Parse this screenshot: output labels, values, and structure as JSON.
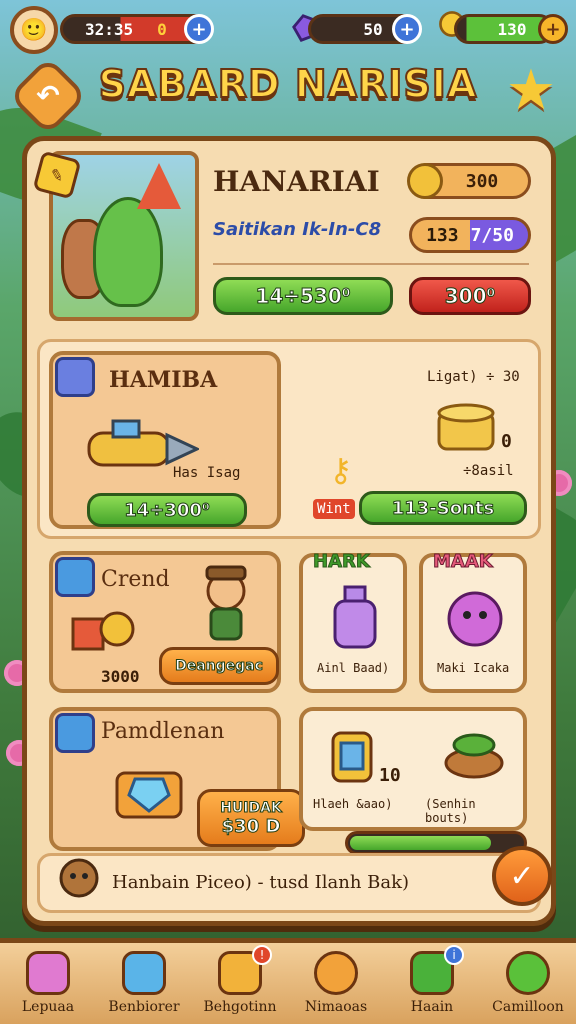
{
  "topbar": {
    "energy_value": "32:35",
    "energy_count": "0",
    "gems_value": "50",
    "coins_value": "130"
  },
  "header": {
    "title": "SABARD NARISIA"
  },
  "hero": {
    "name": "HANARIAI",
    "subtitle": "Saitikan Ik-In-C8",
    "coin_amount": "300",
    "progress_left": "133",
    "progress_right": "7/50",
    "green_button": "14÷530⁰",
    "red_button": "300⁰"
  },
  "section1": {
    "left_title": "HAMIBA",
    "left_caption": "Has Isag",
    "left_button": "14÷300⁰",
    "right_top_text": "Ligat) ÷ 30",
    "right_counter": "0",
    "right_mid_text": "÷8asil",
    "right_tag": "Wint",
    "right_button": "113-Sonts"
  },
  "section2": {
    "card1_title": "Crend",
    "card1_count": "3000",
    "card1_button": "Deangegac",
    "card2_title": "HARK",
    "card2_caption": "Ainl Baad)",
    "card3_title": "MAAK",
    "card3_caption": "Maki Icaka"
  },
  "section3": {
    "card1_title": "Pamdlenan",
    "card1_button_top": "HUIDAK",
    "card1_button_bottom": "$30 D",
    "card2_count": "10",
    "card2_caption_left": "Hlaeh &aao)",
    "card2_caption_right": "(Senhin bouts)"
  },
  "notice": {
    "text": "Hanbain Piceo) - tusd Ilanh Bak)"
  },
  "nav": [
    {
      "label": "Lepuaa"
    },
    {
      "label": "Benbiorer"
    },
    {
      "label": "Behgotinn"
    },
    {
      "label": "Nimaoas"
    },
    {
      "label": "Haain"
    },
    {
      "label": "Camilloon"
    }
  ]
}
